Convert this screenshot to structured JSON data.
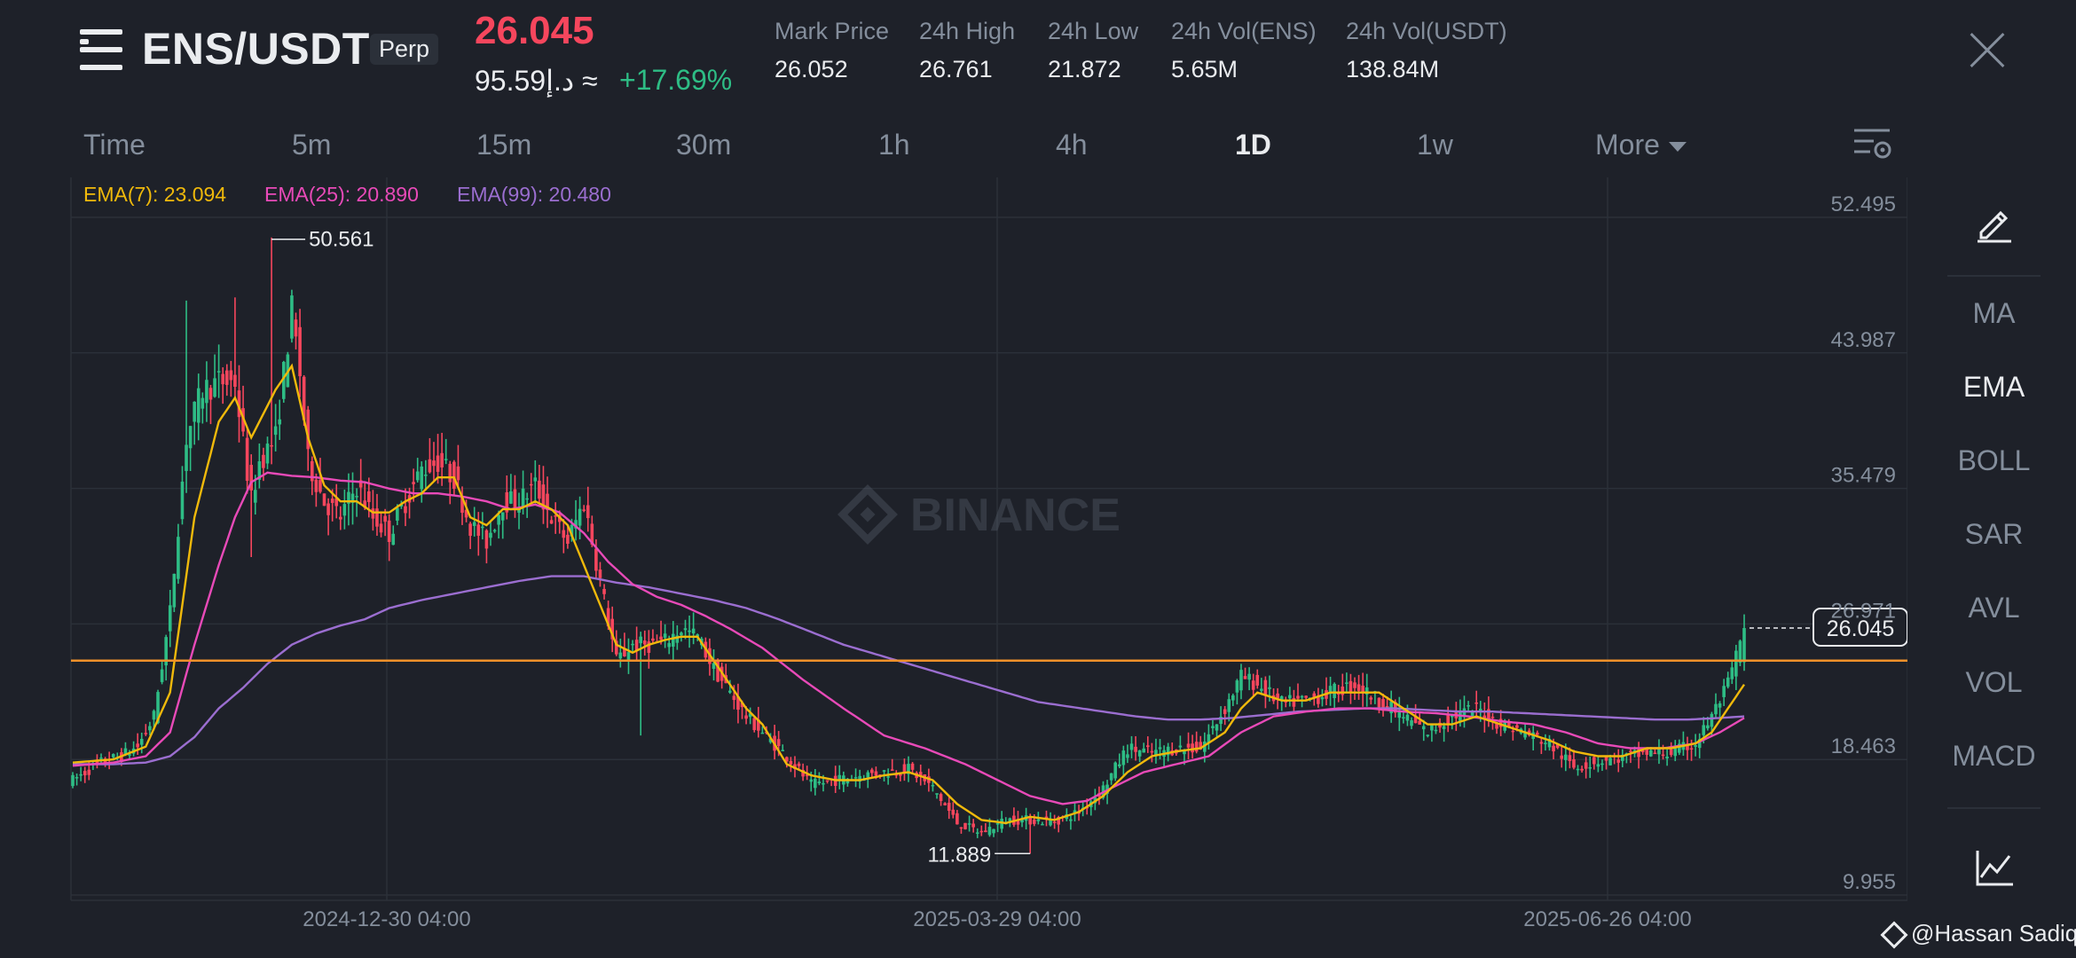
{
  "header": {
    "pair": "ENS/USDT",
    "contract_type": "Perp",
    "last_price": "26.045",
    "fiat_value": "95.59د.إ ≈",
    "change_pct": "+17.69%",
    "stats": [
      {
        "label": "Mark Price",
        "value": "26.052"
      },
      {
        "label": "24h High",
        "value": "26.761"
      },
      {
        "label": "24h Low",
        "value": "21.872"
      },
      {
        "label": "24h Vol(ENS)",
        "value": "5.65M"
      },
      {
        "label": "24h Vol(USDT)",
        "value": "138.84M"
      }
    ],
    "icons": {
      "menu": "menu-icon",
      "close": "close-icon"
    }
  },
  "tabs": [
    {
      "label": "Time",
      "active": false
    },
    {
      "label": "5m",
      "active": false
    },
    {
      "label": "15m",
      "active": false
    },
    {
      "label": "30m",
      "active": false
    },
    {
      "label": "1h",
      "active": false
    },
    {
      "label": "4h",
      "active": false
    },
    {
      "label": "1D",
      "active": true
    },
    {
      "label": "1w",
      "active": false
    },
    {
      "label": "More",
      "active": false
    }
  ],
  "indicators": [
    {
      "label": "EMA(7): 23.094",
      "color": "#f0b90b"
    },
    {
      "label": "EMA(25): 20.890",
      "color": "#e84ab8"
    },
    {
      "label": "EMA(99): 20.480",
      "color": "#9b6ed0"
    }
  ],
  "side_panel": [
    "MA",
    "EMA",
    "BOLL",
    "SAR",
    "AVL",
    "VOL",
    "MACD"
  ],
  "side_panel_active": "EMA",
  "colors": {
    "up": "#2ebd85",
    "down": "#f6465d",
    "ema7": "#f0b90b",
    "ema25": "#e84ab8",
    "ema99": "#9b6ed0",
    "price_line": "#f0912a",
    "grid": "#2b3039",
    "axis_text": "#848e9c"
  },
  "watermark": "BINANCE",
  "credit": "@Hassan Sadiq",
  "chart_data": {
    "type": "candlestick",
    "y_ticks": [
      "52.495",
      "43.987",
      "35.479",
      "26.971",
      "18.463",
      "9.955"
    ],
    "ylim": [
      9.955,
      52.495
    ],
    "x_ticks": [
      "2024-12-30 04:00",
      "2025-03-29 04:00",
      "2025-06-26 04:00"
    ],
    "current_price": "26.045",
    "current_price_value": 26.045,
    "high_label": "50.561",
    "high_value": 50.561,
    "low_label": "11.889",
    "low_value": 11.889,
    "horizontal_line": 24.0,
    "ema7_knots": [
      [
        0,
        17.6
      ],
      [
        10,
        17.8
      ],
      [
        18,
        18.6
      ],
      [
        24,
        22
      ],
      [
        30,
        33
      ],
      [
        36,
        39
      ],
      [
        40,
        40.5
      ],
      [
        44,
        38
      ],
      [
        48,
        40
      ],
      [
        50,
        41
      ],
      [
        54,
        42.5
      ],
      [
        58,
        38
      ],
      [
        62,
        35
      ],
      [
        66,
        34
      ],
      [
        70,
        34
      ],
      [
        74,
        33.3
      ],
      [
        78,
        33.3
      ],
      [
        82,
        34
      ],
      [
        86,
        34.5
      ],
      [
        90,
        35.5
      ],
      [
        94,
        35.5
      ],
      [
        98,
        33
      ],
      [
        102,
        32.5
      ],
      [
        106,
        33.5
      ],
      [
        110,
        33.5
      ],
      [
        114,
        34
      ],
      [
        118,
        33.5
      ],
      [
        122,
        32.5
      ],
      [
        126,
        30
      ],
      [
        130,
        27.5
      ],
      [
        134,
        25
      ],
      [
        138,
        24.5
      ],
      [
        142,
        25
      ],
      [
        146,
        25.3
      ],
      [
        150,
        25.5
      ],
      [
        154,
        25.5
      ],
      [
        158,
        24
      ],
      [
        162,
        22.5
      ],
      [
        166,
        21
      ],
      [
        170,
        20
      ],
      [
        176,
        17.5
      ],
      [
        182,
        16.8
      ],
      [
        188,
        16.5
      ],
      [
        194,
        16.5
      ],
      [
        200,
        16.8
      ],
      [
        206,
        17
      ],
      [
        212,
        16.5
      ],
      [
        218,
        15
      ],
      [
        224,
        14
      ],
      [
        230,
        13.8
      ],
      [
        236,
        14.2
      ],
      [
        242,
        14
      ],
      [
        248,
        14.5
      ],
      [
        254,
        15.5
      ],
      [
        260,
        17
      ],
      [
        266,
        18
      ],
      [
        272,
        18.3
      ],
      [
        278,
        18.5
      ],
      [
        284,
        19.5
      ],
      [
        288,
        21
      ],
      [
        292,
        22
      ],
      [
        298,
        21.5
      ],
      [
        304,
        21.5
      ],
      [
        310,
        22
      ],
      [
        316,
        22
      ],
      [
        322,
        22
      ],
      [
        328,
        21
      ],
      [
        334,
        20
      ],
      [
        340,
        20
      ],
      [
        346,
        20.5
      ],
      [
        352,
        20
      ],
      [
        358,
        19.5
      ],
      [
        364,
        19
      ],
      [
        370,
        18.3
      ],
      [
        376,
        18
      ],
      [
        382,
        18
      ],
      [
        388,
        18.5
      ],
      [
        394,
        18.5
      ],
      [
        400,
        18.8
      ],
      [
        404,
        19.5
      ],
      [
        408,
        21
      ],
      [
        412,
        22.5
      ]
    ],
    "ema25_knots": [
      [
        0,
        17.4
      ],
      [
        10,
        17.6
      ],
      [
        18,
        18
      ],
      [
        24,
        19.5
      ],
      [
        30,
        25
      ],
      [
        36,
        30
      ],
      [
        40,
        33
      ],
      [
        44,
        35.2
      ],
      [
        48,
        35.8
      ],
      [
        54,
        35.6
      ],
      [
        60,
        35.5
      ],
      [
        66,
        35.3
      ],
      [
        72,
        35.2
      ],
      [
        78,
        34.8
      ],
      [
        84,
        34.5
      ],
      [
        90,
        34.5
      ],
      [
        96,
        34.3
      ],
      [
        102,
        34
      ],
      [
        108,
        33.5
      ],
      [
        114,
        33.8
      ],
      [
        120,
        33.3
      ],
      [
        126,
        32
      ],
      [
        132,
        30.2
      ],
      [
        138,
        28.8
      ],
      [
        144,
        28
      ],
      [
        150,
        27.5
      ],
      [
        156,
        26.8
      ],
      [
        162,
        26
      ],
      [
        170,
        24.8
      ],
      [
        180,
        22.8
      ],
      [
        190,
        21
      ],
      [
        200,
        19.3
      ],
      [
        210,
        18.5
      ],
      [
        220,
        17.5
      ],
      [
        228,
        16.5
      ],
      [
        236,
        15.5
      ],
      [
        244,
        15
      ],
      [
        250,
        15.2
      ],
      [
        256,
        16
      ],
      [
        264,
        17
      ],
      [
        272,
        17.5
      ],
      [
        280,
        18
      ],
      [
        288,
        19.5
      ],
      [
        296,
        20.5
      ],
      [
        304,
        20.8
      ],
      [
        312,
        21
      ],
      [
        320,
        21
      ],
      [
        328,
        20.8
      ],
      [
        336,
        20.7
      ],
      [
        344,
        20.5
      ],
      [
        352,
        20.2
      ],
      [
        360,
        20
      ],
      [
        368,
        19.5
      ],
      [
        376,
        18.8
      ],
      [
        384,
        18.5
      ],
      [
        392,
        18.5
      ],
      [
        400,
        18.8
      ],
      [
        406,
        19.5
      ],
      [
        412,
        20.4
      ]
    ],
    "ema99_knots": [
      [
        0,
        17.5
      ],
      [
        10,
        17.5
      ],
      [
        18,
        17.6
      ],
      [
        24,
        18
      ],
      [
        30,
        19.2
      ],
      [
        36,
        21
      ],
      [
        42,
        22.3
      ],
      [
        48,
        23.8
      ],
      [
        54,
        25
      ],
      [
        60,
        25.7
      ],
      [
        66,
        26.2
      ],
      [
        72,
        26.6
      ],
      [
        78,
        27.3
      ],
      [
        86,
        27.8
      ],
      [
        94,
        28.2
      ],
      [
        102,
        28.6
      ],
      [
        110,
        29
      ],
      [
        118,
        29.3
      ],
      [
        126,
        29.3
      ],
      [
        134,
        28.9
      ],
      [
        142,
        28.6
      ],
      [
        150,
        28.2
      ],
      [
        158,
        27.8
      ],
      [
        166,
        27.3
      ],
      [
        174,
        26.6
      ],
      [
        182,
        25.8
      ],
      [
        190,
        25
      ],
      [
        198,
        24.4
      ],
      [
        206,
        23.8
      ],
      [
        214,
        23.2
      ],
      [
        222,
        22.6
      ],
      [
        230,
        22
      ],
      [
        238,
        21.4
      ],
      [
        246,
        21.1
      ],
      [
        254,
        20.8
      ],
      [
        262,
        20.5
      ],
      [
        270,
        20.3
      ],
      [
        278,
        20.3
      ],
      [
        286,
        20.4
      ],
      [
        294,
        20.6
      ],
      [
        302,
        20.8
      ],
      [
        310,
        20.9
      ],
      [
        318,
        21
      ],
      [
        326,
        21
      ],
      [
        334,
        20.9
      ],
      [
        342,
        20.8
      ],
      [
        350,
        20.8
      ],
      [
        358,
        20.7
      ],
      [
        366,
        20.6
      ],
      [
        374,
        20.5
      ],
      [
        382,
        20.4
      ],
      [
        390,
        20.3
      ],
      [
        398,
        20.3
      ],
      [
        406,
        20.4
      ],
      [
        412,
        20.5
      ]
    ],
    "price_knots": [
      [
        0,
        16.5
      ],
      [
        6,
        17.5
      ],
      [
        12,
        18
      ],
      [
        16,
        18.6
      ],
      [
        20,
        20.5
      ],
      [
        24,
        27
      ],
      [
        28,
        38
      ],
      [
        32,
        41
      ],
      [
        36,
        41.5
      ],
      [
        40,
        41.5
      ],
      [
        44,
        34
      ],
      [
        46,
        36.5
      ],
      [
        50,
        38
      ],
      [
        54,
        46
      ],
      [
        56,
        42
      ],
      [
        58,
        36.5
      ],
      [
        62,
        34
      ],
      [
        66,
        33
      ],
      [
        70,
        35
      ],
      [
        74,
        33
      ],
      [
        78,
        32
      ],
      [
        82,
        34
      ],
      [
        86,
        36
      ],
      [
        90,
        36.5
      ],
      [
        94,
        35.5
      ],
      [
        98,
        32.5
      ],
      [
        102,
        31.5
      ],
      [
        106,
        34
      ],
      [
        110,
        34
      ],
      [
        114,
        35
      ],
      [
        118,
        33
      ],
      [
        122,
        31.5
      ],
      [
        126,
        34
      ],
      [
        130,
        29
      ],
      [
        134,
        24
      ],
      [
        138,
        25
      ],
      [
        142,
        25
      ],
      [
        146,
        25.2
      ],
      [
        150,
        26
      ],
      [
        154,
        25.5
      ],
      [
        158,
        23.5
      ],
      [
        162,
        22
      ],
      [
        166,
        20.5
      ],
      [
        170,
        19.5
      ],
      [
        176,
        18
      ],
      [
        182,
        16.2
      ],
      [
        188,
        16.5
      ],
      [
        194,
        16.8
      ],
      [
        200,
        17
      ],
      [
        206,
        17.2
      ],
      [
        212,
        16
      ],
      [
        218,
        13.8
      ],
      [
        224,
        13.2
      ],
      [
        230,
        14
      ],
      [
        236,
        14
      ],
      [
        242,
        13.9
      ],
      [
        248,
        14.5
      ],
      [
        254,
        16
      ],
      [
        260,
        18.5
      ],
      [
        266,
        18.2
      ],
      [
        272,
        18.5
      ],
      [
        278,
        18.5
      ],
      [
        284,
        21
      ],
      [
        288,
        23
      ],
      [
        292,
        22.5
      ],
      [
        298,
        21.3
      ],
      [
        304,
        21.5
      ],
      [
        310,
        22
      ],
      [
        316,
        22.5
      ],
      [
        322,
        21.5
      ],
      [
        328,
        20.5
      ],
      [
        334,
        19.5
      ],
      [
        340,
        20.5
      ],
      [
        346,
        21
      ],
      [
        352,
        20
      ],
      [
        358,
        19.5
      ],
      [
        364,
        18.8
      ],
      [
        370,
        17.3
      ],
      [
        376,
        17.7
      ],
      [
        382,
        17.9
      ],
      [
        388,
        18.2
      ],
      [
        394,
        18.2
      ],
      [
        400,
        18.8
      ],
      [
        404,
        20.5
      ],
      [
        408,
        22.5
      ],
      [
        412,
        26.045
      ]
    ],
    "wick_down_candles": [
      [
        72,
        28.5
      ],
      [
        236,
        11.889
      ],
      [
        140,
        20
      ],
      [
        68,
        30.5
      ]
    ]
  }
}
